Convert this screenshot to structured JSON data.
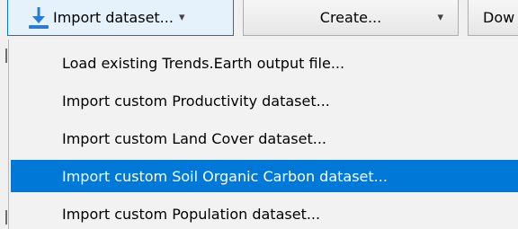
{
  "toolbar": {
    "import_label": "Import dataset...",
    "create_label": "Create...",
    "download_label": "Dow",
    "dropdown_glyph": "▾"
  },
  "menu": {
    "items": [
      {
        "label": "Load existing Trends.Earth output file..."
      },
      {
        "label": "Import custom Productivity dataset..."
      },
      {
        "label": "Import custom Land Cover dataset..."
      },
      {
        "label": "Import custom Soil Organic Carbon dataset..."
      },
      {
        "label": "Import custom Population dataset..."
      }
    ],
    "selected_index": 3
  },
  "colors": {
    "highlight": "#0078d7",
    "menu_bg": "#f2f2f2",
    "icon_blue": "#2b7bd6"
  },
  "icons": {
    "import": "download-tray-icon",
    "dropdown": "chevron-down-icon"
  }
}
